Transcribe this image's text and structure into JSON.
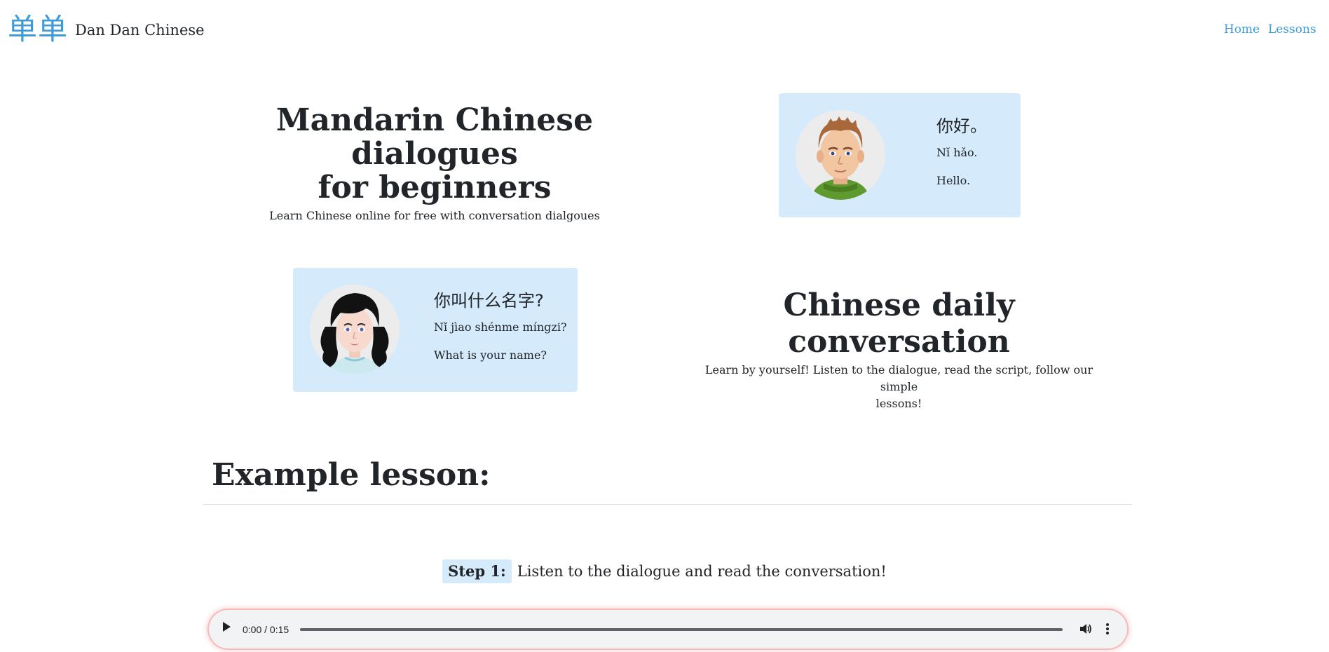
{
  "navbar": {
    "logo_text": "单单",
    "brand_name": "Dan Dan Chinese",
    "links": {
      "home": "Home",
      "lessons": "Lessons"
    }
  },
  "hero1": {
    "title_line1": "Mandarin Chinese dialogues",
    "title_line2": "for beginners",
    "subtitle": "Learn Chinese online for free with conversation dialgoues"
  },
  "card1": {
    "avatar": "boy-avatar",
    "hanzi": "你好。",
    "pinyin": "Nǐ hǎo.",
    "english": "Hello."
  },
  "card2": {
    "avatar": "girl-avatar",
    "hanzi": "你叫什么名字?",
    "pinyin": "Nǐ jìao shénme míngzi?",
    "english": "What is your name?"
  },
  "hero2": {
    "title": "Chinese daily conversation",
    "subtitle_line1": "Learn by yourself! Listen to the dialogue, read the script, follow our simple",
    "subtitle_line2": "lessons!"
  },
  "example": {
    "title": "Example lesson:",
    "step_label": "Step 1:",
    "step_text": "Listen to the dialogue and read the conversation!"
  },
  "audio": {
    "time": "0:00 / 0:15",
    "icons": [
      "play-icon",
      "volume-icon",
      "more-options-icon"
    ]
  },
  "colors": {
    "accent": "#3d9bd9",
    "card_background": "#d5eafb",
    "text": "#212529"
  }
}
